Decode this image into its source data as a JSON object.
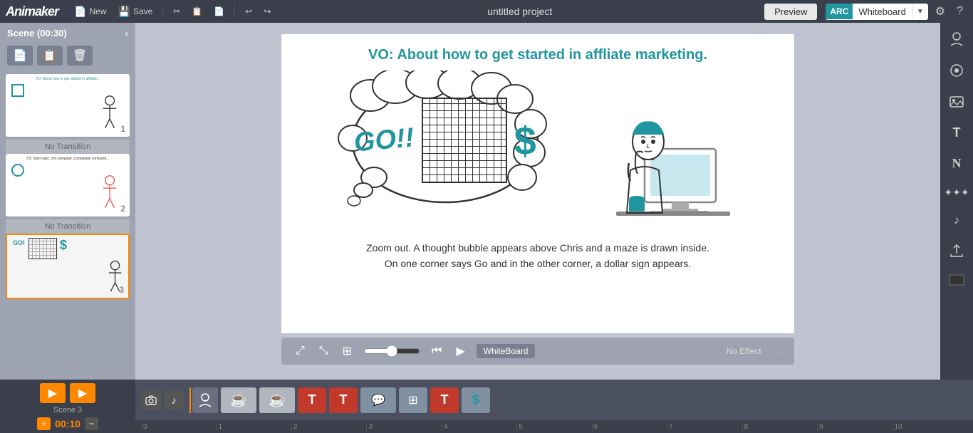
{
  "app": {
    "brand": "Animaker",
    "brand_suffix": ""
  },
  "toolbar": {
    "new_label": "New",
    "save_label": "Save",
    "undo_icon": "↩",
    "redo_icon": "↪",
    "project_title": "untitled project",
    "preview_label": "Preview",
    "whiteboard_label": "Whiteboard",
    "gear_icon": "⚙",
    "help_icon": "?"
  },
  "left_panel": {
    "scene_label": "Scene  (00:30)",
    "no_transition": "No Transition",
    "scenes": [
      {
        "id": 1,
        "active": false,
        "text_preview": "VO: About how to get started in affiliate...",
        "num": "1"
      },
      {
        "id": 2,
        "active": false,
        "text_preview": "7/2: Start topic: 1% computer, completely confused...",
        "num": "2"
      },
      {
        "id": 3,
        "active": true,
        "text_preview": "GOI",
        "num": "3"
      }
    ]
  },
  "canvas": {
    "vo_text": "VO: About how to get started in affliate marketing.",
    "go_text": "GO!!",
    "dollar_text": "$",
    "caption_line1": "Zoom out. A thought bubble appears above Chris and a maze is drawn inside.",
    "caption_line2": "On one corner says Go and in the other corner, a dollar sign appears."
  },
  "playback": {
    "whiteboard_label": "WhiteBoard",
    "no_effect_label": "No Effect",
    "fit_label": "⤢",
    "expand_label": "⤡",
    "grid_label": "⊞",
    "prev_label": "⏮",
    "play_label": "▶",
    "play_all_label": "▶"
  },
  "right_panel": {
    "tools": [
      {
        "name": "character-icon",
        "icon": "👤",
        "label": "Character"
      },
      {
        "name": "props-icon",
        "icon": "◉",
        "label": "Props"
      },
      {
        "name": "image-icon",
        "icon": "🖼",
        "label": "Image"
      },
      {
        "name": "text-icon",
        "icon": "T",
        "label": "Text"
      },
      {
        "name": "font-icon",
        "icon": "N",
        "label": "Font"
      },
      {
        "name": "effects-icon",
        "icon": "✦",
        "label": "Effects"
      },
      {
        "name": "music-icon",
        "icon": "♪",
        "label": "Music"
      },
      {
        "name": "upload-icon",
        "icon": "⬆",
        "label": "Upload"
      },
      {
        "name": "bg-icon",
        "icon": "▬",
        "label": "Background"
      }
    ]
  },
  "timeline": {
    "scene_label": "Scene 3",
    "time_display": "00:10",
    "add_time_label": "+",
    "remove_time_label": "−",
    "clips": [
      {
        "type": "char",
        "icon": "👤",
        "color": "#6a7080"
      },
      {
        "type": "cup",
        "icon": "☕",
        "color": "#a0a5b0"
      },
      {
        "type": "cup2",
        "icon": "☕",
        "color": "#a0a5b0"
      },
      {
        "type": "red1",
        "icon": "T",
        "color": "#c0392b"
      },
      {
        "type": "red2",
        "icon": "T",
        "color": "#c0392b"
      },
      {
        "type": "bubble",
        "icon": "💬",
        "color": "#a0a5b0"
      },
      {
        "type": "maze",
        "icon": "⊞",
        "color": "#a0a5b0"
      },
      {
        "type": "red3",
        "icon": "T",
        "color": "#c0392b"
      },
      {
        "type": "dollar",
        "icon": "$",
        "color": "#a0a5b0"
      }
    ],
    "ruler_marks": [
      "0",
      "1",
      "2",
      "3",
      "4",
      "5",
      "6",
      "7",
      "8",
      "9",
      "10"
    ]
  }
}
